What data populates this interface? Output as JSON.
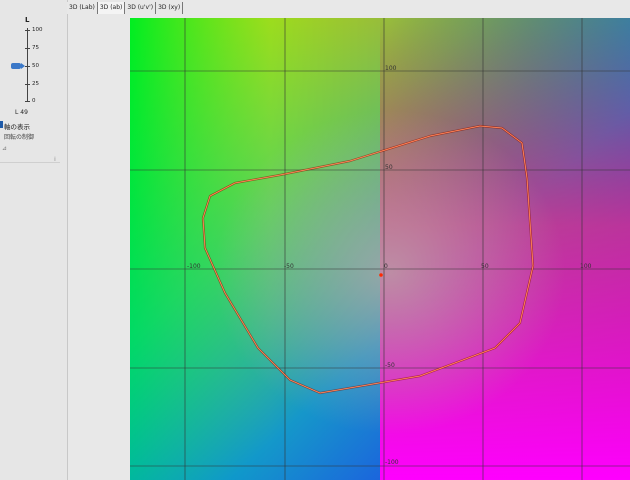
{
  "tabs": [
    {
      "label": "3D (Lab)"
    },
    {
      "label": "3D (ab)"
    },
    {
      "label": "3D (u'v')"
    },
    {
      "label": "3D (xy)"
    }
  ],
  "active_tab": 1,
  "slider": {
    "title": "L",
    "ticks": [
      "100",
      "75",
      "50",
      "25",
      "0"
    ],
    "value": 49,
    "readout": "L 49"
  },
  "options": {
    "show_axes_label": "軸の表示",
    "rotation_control_label": "回転の制御",
    "small_glyph": "⊿",
    "scroll_mark": "⁞"
  },
  "plot": {
    "axis_labels": {
      "a_neg100": "-100",
      "a_neg50": "-50",
      "a_zero": "0",
      "a_50": "50",
      "a_100": "100",
      "b_100": "100",
      "b_50": "50",
      "b_neg50": "-50",
      "b_neg100": "-100"
    },
    "grid_color": "#444444",
    "gamut_color": "#ff3b10",
    "origin_color": "#ff2a00"
  }
}
